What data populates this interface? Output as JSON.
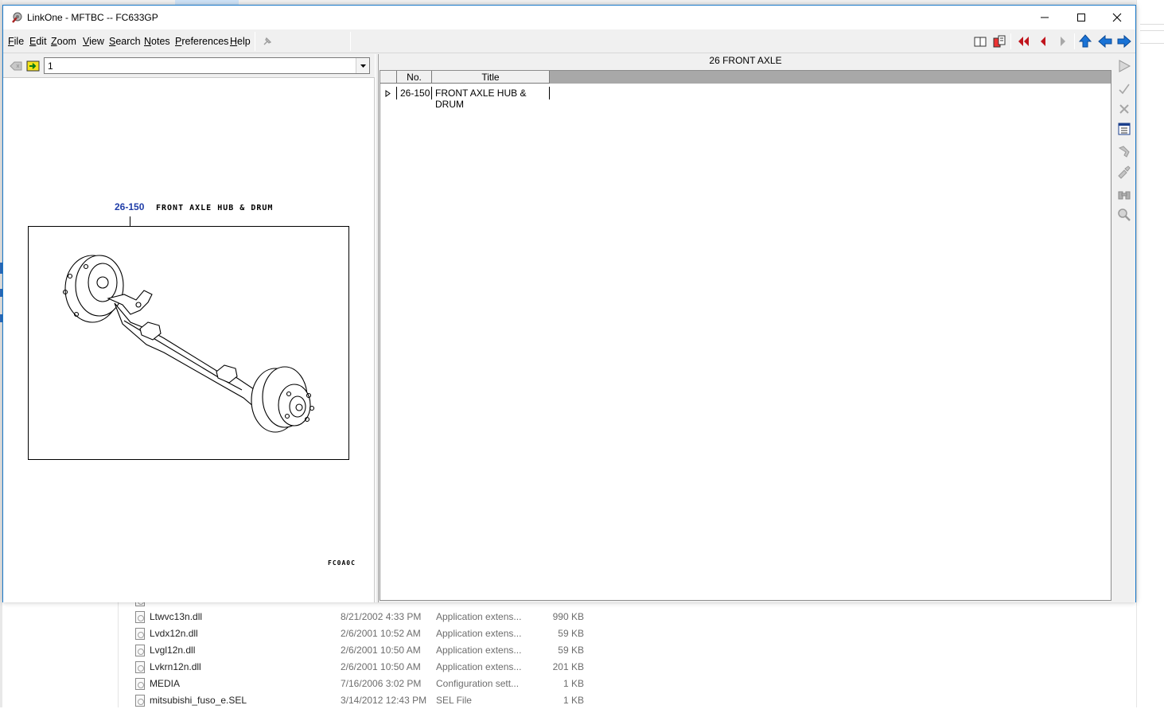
{
  "window": {
    "title": "LinkOne - MFTBC -- FC633GP",
    "controls": [
      "minimize",
      "maximize",
      "close"
    ]
  },
  "menu": {
    "items": [
      {
        "label": "File",
        "mnemonic": "F",
        "rest": "ile"
      },
      {
        "label": "Edit",
        "mnemonic": "E",
        "rest": "dit"
      },
      {
        "label": "Zoom",
        "mnemonic": "Z",
        "rest": "oom"
      },
      {
        "label": "View",
        "mnemonic": "V",
        "rest": "iew"
      },
      {
        "label": "Search",
        "mnemonic": "S",
        "rest": "earch"
      },
      {
        "label": "Notes",
        "mnemonic": "N",
        "rest": "otes"
      },
      {
        "label": "Preferences",
        "mnemonic": "P",
        "rest": "references"
      },
      {
        "label": "Help",
        "mnemonic": "H",
        "rest": "elp"
      }
    ]
  },
  "toolbar": {
    "icons": [
      "pin-icon",
      "book-icon",
      "books-icon",
      "first-page-icon",
      "previous-icon",
      "next-icon",
      "up-icon",
      "back-icon",
      "forward-icon"
    ]
  },
  "left_pane": {
    "combo_value": "1",
    "illustration": {
      "callout_number": "26-150",
      "callout_title": "FRONT AXLE HUB & DRUM",
      "code": "FC0A0C"
    }
  },
  "right_pane": {
    "header": "26 FRONT AXLE",
    "columns": [
      "No.",
      "Title"
    ],
    "rows": [
      {
        "no": "26-150",
        "title": "FRONT AXLE HUB & DRUM"
      }
    ]
  },
  "right_toolbar": {
    "icons": [
      "go-icon",
      "check-icon",
      "delete-icon",
      "list-icon",
      "tool-icon",
      "edit-tool-icon",
      "binoculars-icon",
      "magnifier-icon"
    ]
  },
  "background_explorer": {
    "files": [
      {
        "name": "Ltwvc13n.dll",
        "date": "8/21/2002 4:33 PM",
        "type": "Application extens...",
        "size": "990 KB"
      },
      {
        "name": "Lvdx12n.dll",
        "date": "2/6/2001 10:52 AM",
        "type": "Application extens...",
        "size": "59 KB"
      },
      {
        "name": "Lvgl12n.dll",
        "date": "2/6/2001 10:50 AM",
        "type": "Application extens...",
        "size": "59 KB"
      },
      {
        "name": "Lvkrn12n.dll",
        "date": "2/6/2001 10:50 AM",
        "type": "Application extens...",
        "size": "201 KB"
      },
      {
        "name": "MEDIA",
        "date": "7/16/2006 3:02 PM",
        "type": "Configuration sett...",
        "size": "1 KB"
      },
      {
        "name": "mitsubishi_fuso_e.SEL",
        "date": "3/14/2012 12:43 PM",
        "type": "SEL File",
        "size": "1 KB"
      }
    ]
  }
}
